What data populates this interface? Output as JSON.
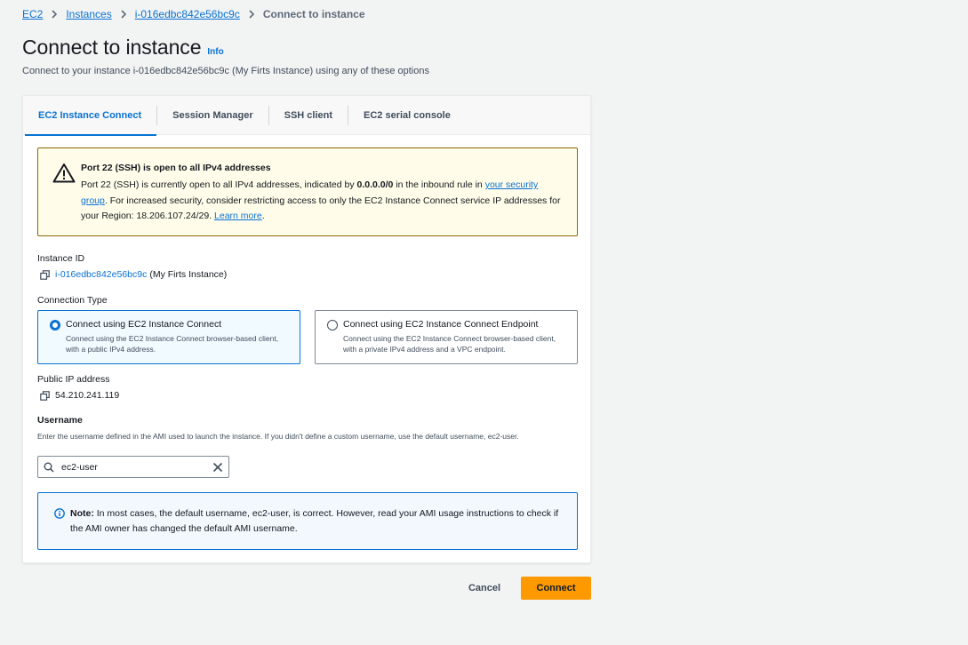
{
  "breadcrumb": {
    "items": [
      "EC2",
      "Instances",
      "i-016edbc842e56bc9c"
    ],
    "current": "Connect to instance"
  },
  "header": {
    "title": "Connect to instance",
    "info": "Info",
    "subtitle": "Connect to your instance i-016edbc842e56bc9c (My Firts Instance) using any of these options"
  },
  "tabs": [
    "EC2 Instance Connect",
    "Session Manager",
    "SSH client",
    "EC2 serial console"
  ],
  "warning": {
    "title": "Port 22 (SSH) is open to all IPv4 addresses",
    "text1": "Port 22 (SSH) is currently open to all IPv4 addresses, indicated by ",
    "cidr": "0.0.0.0/0",
    "text2": " in the inbound rule in ",
    "link1": "your security group",
    "text3": ". For increased security, consider restricting access to only the EC2 Instance Connect service IP addresses for your Region: 18.206.107.24/29. ",
    "link2": "Learn more",
    "text4": "."
  },
  "instance": {
    "label": "Instance ID",
    "id": "i-016edbc842e56bc9c",
    "name": "(My Firts Instance)"
  },
  "connection_type": {
    "label": "Connection Type",
    "options": [
      {
        "title": "Connect using EC2 Instance Connect",
        "desc": "Connect using the EC2 Instance Connect browser-based client, with a public IPv4 address.",
        "selected": true
      },
      {
        "title": "Connect using EC2 Instance Connect Endpoint",
        "desc": "Connect using the EC2 Instance Connect browser-based client, with a private IPv4 address and a VPC endpoint.",
        "selected": false
      }
    ]
  },
  "public_ip": {
    "label": "Public IP address",
    "value": "54.210.241.119"
  },
  "username": {
    "label": "Username",
    "hint": "Enter the username defined in the AMI used to launch the instance. If you didn't define a custom username, use the default username, ec2-user.",
    "value": "ec2-user"
  },
  "note": {
    "bold": "Note:",
    "text": " In most cases, the default username, ec2-user, is correct. However, read your AMI usage instructions to check if the AMI owner has changed the default AMI username."
  },
  "buttons": {
    "cancel": "Cancel",
    "connect": "Connect"
  },
  "colors": {
    "link": "#0972d3",
    "primary_button": "#ff9900",
    "warning_bg": "#fffce9",
    "warning_border": "#8d6605",
    "info_bg": "#f2f8fd"
  }
}
